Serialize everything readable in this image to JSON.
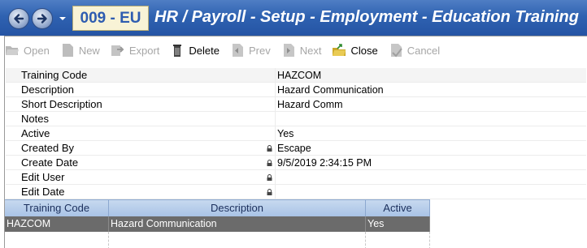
{
  "titlebar": {
    "company_code": "009 - EU",
    "title": "HR / Payroll - Setup - Employment - Education Training"
  },
  "toolbar": {
    "open": "Open",
    "new": "New",
    "export": "Export",
    "delete": "Delete",
    "prev": "Prev",
    "next": "Next",
    "close": "Close",
    "cancel": "Cancel"
  },
  "fields": [
    {
      "label": "Training Code",
      "value": "HAZCOM"
    },
    {
      "label": "Description",
      "value": "Hazard Communication"
    },
    {
      "label": "Short Description",
      "value": "Hazard Comm"
    },
    {
      "label": "Notes",
      "value": ""
    },
    {
      "label": "Active",
      "value": "Yes"
    },
    {
      "label": "Created By",
      "value": "Escape"
    },
    {
      "label": "Create Date",
      "value": "9/5/2019 2:34:15 PM"
    },
    {
      "label": "Edit User",
      "value": ""
    },
    {
      "label": "Edit Date",
      "value": ""
    }
  ],
  "table": {
    "headers": [
      "Training Code",
      "Description",
      "Active"
    ],
    "rows": [
      [
        "HAZCOM",
        "Hazard Communication",
        "Yes"
      ]
    ]
  }
}
